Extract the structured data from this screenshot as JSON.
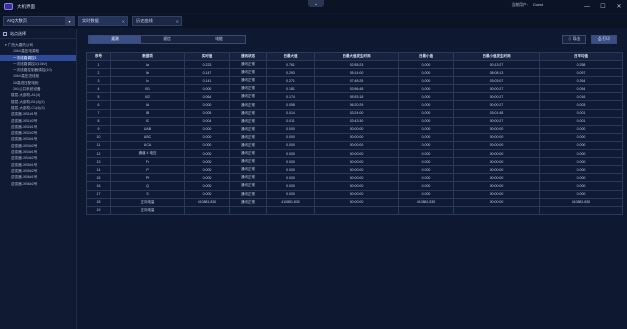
{
  "titlebar": {
    "app_title": "大机界面",
    "user_label": "当前用户:",
    "user_name": "Guest",
    "minimize": "—",
    "maximize": "☐",
    "close": "✕",
    "center_toggle": "⌄"
  },
  "site_selector": {
    "value": "ArQ大数页",
    "chevron": "▾"
  },
  "tabs": [
    {
      "label": "实时数据",
      "close": "✕"
    },
    {
      "label": "历史曲线",
      "close": "✕"
    }
  ],
  "sidebar": {
    "heading": "站点选择",
    "items": [
      {
        "label": "▾ 广西大唐热公司",
        "level": "root"
      },
      {
        "label": "10kV高压电源柜",
        "level": "l1"
      },
      {
        "label": "一次线路调控1",
        "level": "l1",
        "selected": true
      },
      {
        "label": "一次线路调控2(10kV)",
        "level": "l1"
      },
      {
        "label": "一次线路控制器调控(10)",
        "level": "l1"
      },
      {
        "label": "10kV高压进线柜",
        "level": "l1"
      },
      {
        "label": "2#高低压配电柜",
        "level": "l1"
      },
      {
        "label": "2#1公共系统设备",
        "level": "l1"
      },
      {
        "label": "楼层-大部机-A1(4)",
        "level": "l1"
      },
      {
        "label": "楼层-大部机-B1(4)(2)",
        "level": "l1"
      },
      {
        "label": "楼层-大部机-C1(4)(3)",
        "level": "l1"
      },
      {
        "label": "逆变器-XB1#1号",
        "level": "l1"
      },
      {
        "label": "逆变器-XB1#2号",
        "level": "l1"
      },
      {
        "label": "逆变器-XB2#1号",
        "level": "l1"
      },
      {
        "label": "逆变器-XB2#2号",
        "level": "l1"
      },
      {
        "label": "逆变器-XB3#1号",
        "level": "l1"
      },
      {
        "label": "逆变器-XB3#2号",
        "level": "l1"
      },
      {
        "label": "逆变器-XB4#1号",
        "level": "l1"
      },
      {
        "label": "逆变器-XB4#2号",
        "level": "l1"
      },
      {
        "label": "逆变器-XB5#1号",
        "level": "l1"
      },
      {
        "label": "逆变器-XB5#2号",
        "level": "l1"
      },
      {
        "label": "逆变器-XB6#1号",
        "level": "l1"
      },
      {
        "label": "逆变器-XB6#2号",
        "level": "l1"
      }
    ]
  },
  "toolbar": {
    "segments": [
      "遥测",
      "遥信",
      "电能"
    ],
    "active_segment": 0,
    "export_label": "⇩ 导出",
    "print_label": "⎙ 打印"
  },
  "table": {
    "columns": [
      "序号",
      "数据项",
      "实时值",
      "通讯状态",
      "日最大值",
      "日最大值发生时间",
      "日最小值",
      "日最小值发生时间",
      "日平均值"
    ],
    "rows": [
      [
        "1",
        "Ia",
        "0.223",
        "通讯正常",
        "0.761",
        "02:55:23",
        "0.000",
        "00:13:27",
        "0.258"
      ],
      [
        "2",
        "Ib",
        "0.147",
        "通讯正常",
        "0.293",
        "05:14:00",
        "0.000",
        "08:08:13",
        "0.097"
      ],
      [
        "3",
        "Ic",
        "0.141",
        "通讯正常",
        "0.271",
        "07:48:25",
        "0.000",
        "03:03:07",
        "0.264"
      ],
      [
        "4",
        "I01",
        "0.000",
        "通讯正常",
        "0.181",
        "03:56:48",
        "0.000",
        "00:00:27",
        "0.054"
      ],
      [
        "5",
        "I02",
        "0.064",
        "通讯正常",
        "0.174",
        "05:53:18",
        "0.000",
        "00:00:27",
        "0.016"
      ],
      [
        "6",
        "IA",
        "0.000",
        "通讯正常",
        "0.058",
        "06:20:29",
        "0.000",
        "00:00:27",
        "0.003"
      ],
      [
        "7",
        "IB",
        "0.005",
        "通讯正常",
        "0.014",
        "03:24:00",
        "0.000",
        "03:01:48",
        "0.001"
      ],
      [
        "8",
        "IC",
        "0.004",
        "通讯正常",
        "0.011",
        "03:43:30",
        "0.000",
        "00:00:27",
        "0.001"
      ],
      [
        "9",
        "UAB",
        "0.000",
        "通讯正常",
        "0.000",
        "00:00:00",
        "0.000",
        "00:00:00",
        "0.000"
      ],
      [
        "10",
        "UBC",
        "0.000",
        "通讯正常",
        "0.000",
        "00:00:00",
        "0.000",
        "00:00:00",
        "0.000"
      ],
      [
        "11",
        "UCA",
        "0.000",
        "通讯正常",
        "0.000",
        "00:00:00",
        "0.000",
        "00:00:00",
        "0.000"
      ],
      [
        "12",
        "通道 4 电压",
        "0.000",
        "通讯正常",
        "0.000",
        "00:00:00",
        "0.000",
        "00:00:00",
        "0.000"
      ],
      [
        "13",
        "Fr",
        "0.000",
        "通讯正常",
        "0.000",
        "00:00:00",
        "0.000",
        "00:00:00",
        "0.000"
      ],
      [
        "14",
        "P",
        "0.000",
        "通讯正常",
        "0.000",
        "00:00:00",
        "0.000",
        "00:00:00",
        "0.000"
      ],
      [
        "15",
        "Pf",
        "0.000",
        "通讯正常",
        "0.000",
        "00:00:00",
        "0.000",
        "00:00:00",
        "0.000"
      ],
      [
        "16",
        "Q",
        "0.000",
        "通讯正常",
        "0.000",
        "00:00:00",
        "0.000",
        "00:00:00",
        "0.000"
      ],
      [
        "17",
        "S",
        "0.000",
        "通讯正常",
        "0.000",
        "00:00:00",
        "0.000",
        "00:00:00",
        "0.000"
      ],
      [
        "18",
        "正向电量",
        "410881.830",
        "通讯正常",
        "410881.830",
        "00:00:00",
        "410881.830",
        "00:00:00",
        "410881.830"
      ],
      [
        "19",
        "正向电量",
        "",
        "",
        "",
        "",
        "",
        "",
        ""
      ]
    ]
  }
}
